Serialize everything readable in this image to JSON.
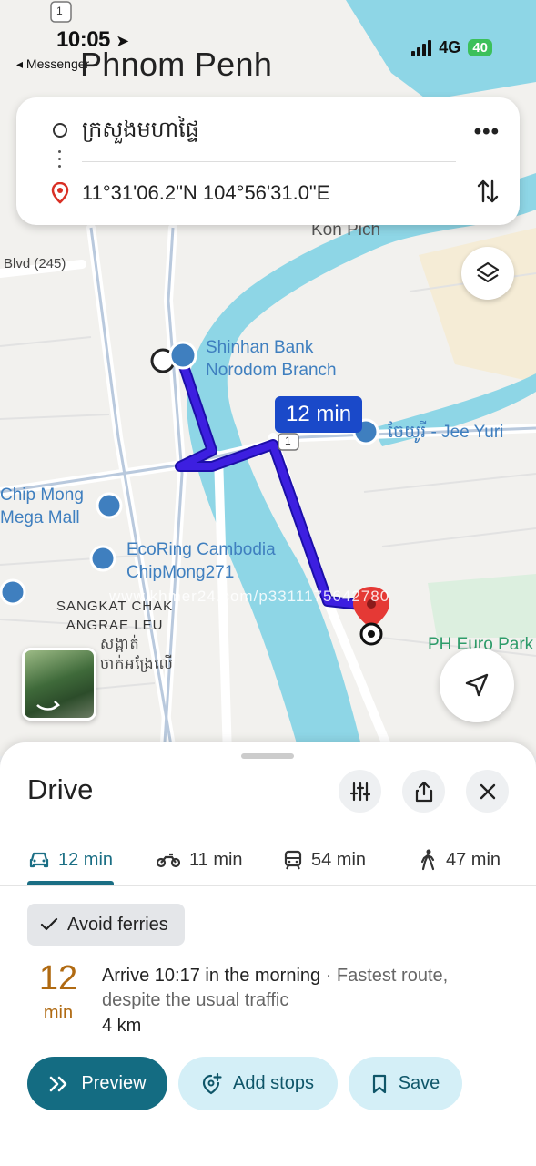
{
  "status_bar": {
    "time": "10:05",
    "back_app": "◂ Messenger",
    "network": "4G",
    "battery": "40"
  },
  "map": {
    "city": "Phnom Penh",
    "labels": {
      "kon_pich": "Kon Pich",
      "blvd": "Blvd (245)",
      "shinhan": "Shinhan Bank\nNorodom Branch",
      "jee_yuri": "ចែយូរី - Jee Yuri",
      "chip_mong": "Chip Mong\nMega Mall",
      "ecoring": "EcoRing Cambodia\nChipMong271",
      "sangkat": "SANGKAT CHAK\nANGRAE LEU",
      "sangkat_kh": "សង្កាត់\nចាក់អង្រែលើ",
      "ph_euro": "PH Euro Park",
      "route_1": "1",
      "watermark": "www.khmer24.com/p3311175642780"
    },
    "route_time": "12 min"
  },
  "route_card": {
    "origin": "ក្រសួងមហាផ្ទៃ",
    "destination": "11°31'06.2\"N 104°56'31.0\"E",
    "more": "•••"
  },
  "sheet": {
    "title": "Drive",
    "modes": [
      {
        "label": "12 min",
        "icon": "car-icon"
      },
      {
        "label": "11 min",
        "icon": "motorcycle-icon"
      },
      {
        "label": "54 min",
        "icon": "transit-icon"
      },
      {
        "label": "47 min",
        "icon": "walk-icon"
      }
    ],
    "avoid_chip": "Avoid ferries",
    "duration_number": "12",
    "duration_unit": "min",
    "arrive_main": "Arrive 10:17 in the morning",
    "arrive_sub": " · Fastest route, despite the usual traffic",
    "distance": "4 km",
    "buttons": {
      "preview": "Preview",
      "add_stops": "Add stops",
      "save": "Save"
    }
  },
  "colors": {
    "route": "#3d1fe0",
    "accent": "#146c82",
    "water": "#8ed6e6",
    "duration": "#b06a12"
  }
}
